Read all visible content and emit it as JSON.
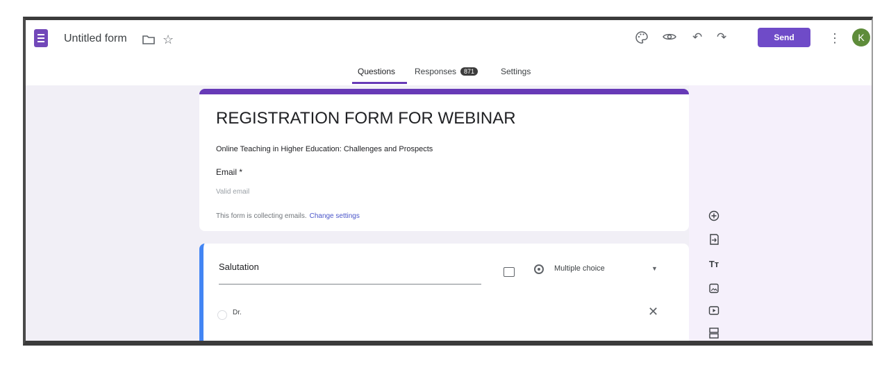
{
  "app": {
    "title": "Untitled form",
    "avatar_letter": "K",
    "send_label": "Send",
    "accent_color": "#673ab7"
  },
  "header_icons": [
    "folder-icon",
    "star-icon",
    "palette-icon",
    "preview-icon",
    "undo-icon",
    "redo-icon",
    "more-vert-icon"
  ],
  "tabs": [
    {
      "label": "Questions",
      "active": true
    },
    {
      "label": "Responses",
      "badge": "871"
    },
    {
      "label": "Settings"
    }
  ],
  "form": {
    "title": "REGISTRATION FORM FOR WEBINAR",
    "description": "Online Teaching in Higher Education: Challenges and Prospects",
    "email_label": "Email *",
    "email_placeholder": "Valid email",
    "collecting_note": "This form is collecting emails.",
    "change_settings_link": "Change settings"
  },
  "question": {
    "title": "Salutation",
    "type": "Multiple choice",
    "options": [
      "Dr."
    ]
  },
  "side_toolbar": [
    "add-question-icon",
    "import-questions-icon",
    "add-title-icon",
    "add-image-icon",
    "add-video-icon",
    "add-section-icon"
  ]
}
